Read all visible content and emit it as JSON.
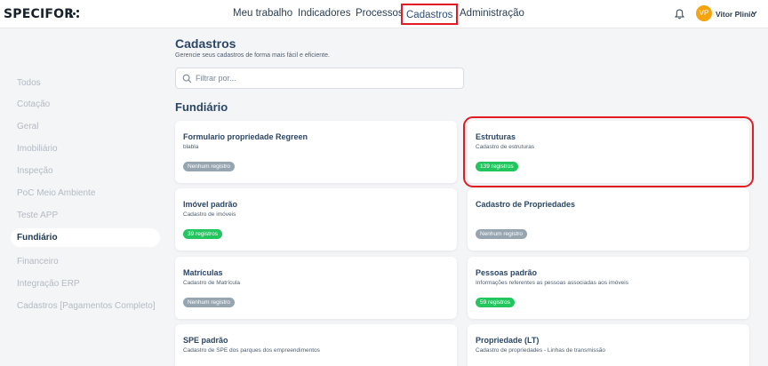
{
  "header": {
    "logo": "SPECIFOR",
    "nav": [
      {
        "label": "Meu trabalho"
      },
      {
        "label": "Indicadores"
      },
      {
        "label": "Processos"
      },
      {
        "label": "Cadastros",
        "active": true
      },
      {
        "label": "Administração"
      }
    ],
    "user": {
      "initials": "VP",
      "name": "Vitor Plinio"
    }
  },
  "sidebar": {
    "items": [
      {
        "label": "Todos"
      },
      {
        "label": "Cotação"
      },
      {
        "label": "Geral"
      },
      {
        "label": "Imobiliário"
      },
      {
        "label": "Inspeção"
      },
      {
        "label": "PoC Meio Ambiente"
      },
      {
        "label": "Teste APP"
      },
      {
        "label": "Fundiário",
        "active": true
      },
      {
        "label": "Financeiro"
      },
      {
        "label": "Integração ERP"
      },
      {
        "label": "Cadastros [Pagamentos Completo]"
      }
    ]
  },
  "main": {
    "title": "Cadastros",
    "subtitle": "Gerencie seus cadastros de forma mais fácil e eficiente.",
    "search_placeholder": "Filtrar por...",
    "section_title": "Fundiário",
    "cards": [
      {
        "title": "Formulario propriedade Regreen",
        "description": "blabla",
        "badge": "Nenhum registro"
      },
      {
        "title": "Estruturas",
        "description": "Cadastro de estruturas",
        "badge": "139 registros"
      },
      {
        "title": "Imóvel padrão",
        "description": "Cadastro de imóveis",
        "badge": "39 registros"
      },
      {
        "title": "Cadastro de Propriedades",
        "description": "",
        "badge": "Nenhum registro"
      },
      {
        "title": "Matrículas",
        "description": "Cadastro de Matrícula",
        "badge": "Nenhum registro"
      },
      {
        "title": "Pessoas padrão",
        "description": "Informações referentes as pessoas associadas aos imóveis",
        "badge": "59 registros"
      },
      {
        "title": "SPE padrão",
        "description": "Cadastro de SPE dos parques dos empreendimentos",
        "badge": ""
      },
      {
        "title": "Propriedade (LT)",
        "description": "Cadastro de propriedades - Linhas de transmissão",
        "badge": ""
      }
    ]
  },
  "colors": {
    "highlight": "#e31b23",
    "badge_success": "#22c55e",
    "badge_empty": "#97a5b1",
    "avatar": "#f5a30f",
    "heading": "#2b4666"
  },
  "icons": [
    "bell-icon",
    "chevron-down-icon",
    "search-icon"
  ]
}
